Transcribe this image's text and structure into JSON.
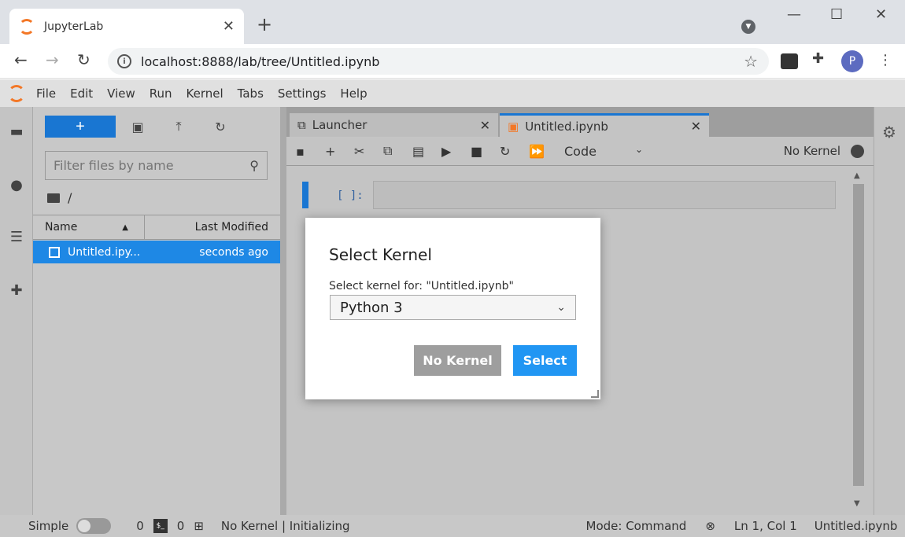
{
  "browser": {
    "tab_title": "JupyterLab",
    "tab_close": "✕",
    "new_tab": "+",
    "url": "localhost:8888/lab/tree/Untitled.ipynb",
    "profile_initial": "P"
  },
  "menu": [
    "File",
    "Edit",
    "View",
    "Run",
    "Kernel",
    "Tabs",
    "Settings",
    "Help"
  ],
  "filebrowser": {
    "new_label": "+",
    "filter_placeholder": "Filter files by name",
    "breadcrumb": "/",
    "col_name": "Name",
    "col_modified": "Last Modified",
    "rows": [
      {
        "name": "Untitled.ipy...",
        "modified": "seconds ago"
      }
    ]
  },
  "tabs": {
    "launcher": "Launcher",
    "notebook": "Untitled.ipynb"
  },
  "notebook": {
    "cell_type": "Code",
    "kernel_name": "No Kernel",
    "prompt": "[ ]:"
  },
  "dialog": {
    "title": "Select Kernel",
    "label": "Select kernel for: \"Untitled.ipynb\"",
    "selected": "Python 3",
    "no_kernel_button": "No Kernel",
    "select_button": "Select"
  },
  "status": {
    "mode_label": "Simple",
    "count1": "0",
    "count2": "0",
    "kernel_status": "No Kernel | Initializing",
    "mode": "Mode: Command",
    "position": "Ln 1, Col 1",
    "filename": "Untitled.ipynb"
  },
  "colors": {
    "accent": "#1976d2",
    "jupyter_orange": "#f37726",
    "select_button": "#2196f3"
  }
}
